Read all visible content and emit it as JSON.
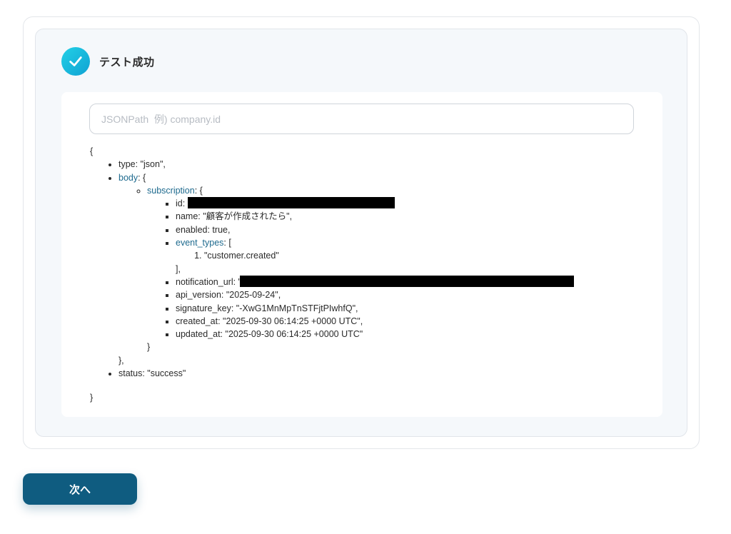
{
  "result": {
    "title": "テスト成功",
    "icon": "check-circle-icon"
  },
  "search": {
    "placeholder": "JSONPath  例) company.id",
    "value": ""
  },
  "json": {
    "open_brace": "{",
    "type_line": "type: \"json\",",
    "body_key": "body",
    "body_open": ": {",
    "subscription_key": "subscription",
    "subscription_open": ": {",
    "id_label": "id: ",
    "name_line": "name: \"顧客が作成されたら\",",
    "enabled_line": "enabled: true,",
    "event_types_key": "event_types",
    "event_types_open": ": [",
    "event_type_item": "\"customer.created\"",
    "event_types_close": "],",
    "notification_url_label": "notification_url: \"",
    "api_version_line": "api_version: \"2025-09-24\",",
    "signature_key_line": "signature_key: \"-XwG1MnMpTnSTFjtPIwhfQ\",",
    "created_at_line": "created_at: \"2025-09-30 06:14:25 +0000 UTC\",",
    "updated_at_line": "updated_at: \"2025-09-30 06:14:25 +0000 UTC\"",
    "subscription_close": "}",
    "body_close": "},",
    "status_line": "status: \"success\"",
    "close_brace": "}"
  },
  "colors": {
    "accent": "#0f5c80",
    "key_link": "#1e6a8e",
    "check_gradient_start": "#23d0e6",
    "check_gradient_end": "#0fa2d3"
  },
  "footer": {
    "next_label": "次へ"
  }
}
